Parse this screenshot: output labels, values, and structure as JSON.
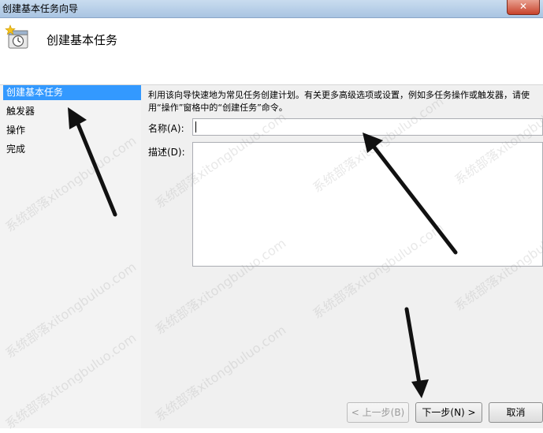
{
  "window": {
    "title": "创建基本任务向导",
    "close_label": "✕"
  },
  "header": {
    "title": "创建基本任务",
    "icon": "task-clock-icon"
  },
  "sidebar": {
    "items": [
      {
        "label": "创建基本任务",
        "active": true
      },
      {
        "label": "触发器",
        "active": false
      },
      {
        "label": "操作",
        "active": false
      },
      {
        "label": "完成",
        "active": false
      }
    ]
  },
  "main": {
    "description": "利用该向导快速地为常见任务创建计划。有关更多高级选项或设置，例如多任务操作或触发器，请使用“操作”窗格中的“创建任务”命令。",
    "name_label": "名称(A):",
    "name_value": "",
    "desc_label": "描述(D):",
    "desc_value": ""
  },
  "footer": {
    "back_label": "< 上一步(B)",
    "next_label": "下一步(N) >",
    "cancel_label": "取消"
  },
  "watermark": {
    "text": "系统部落xitongbuluo.com"
  },
  "colors": {
    "accent": "#3399ff",
    "titlebar": "#b9d1ea",
    "close": "#c8432c"
  }
}
